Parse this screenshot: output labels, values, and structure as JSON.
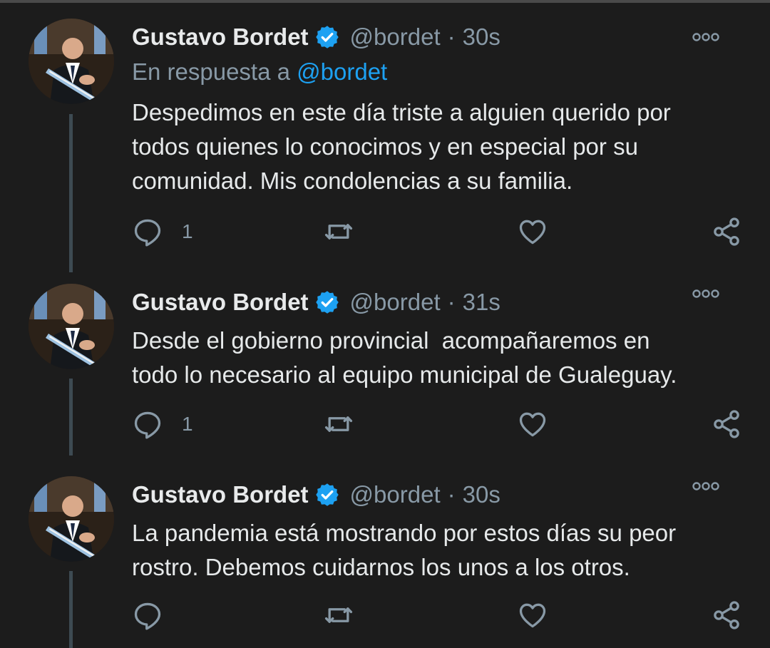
{
  "tweets": [
    {
      "name": "Gustavo Bordet",
      "handle": "@bordet",
      "separator": "·",
      "time": "30s",
      "reply_prefix": "En respuesta a",
      "reply_mention": "@bordet",
      "lines": [
        "Despedimos en este día triste a alguien querido por",
        "todos quienes lo conocimos y en especial por su",
        "comunidad. Mis condolencias a su familia."
      ],
      "reply_count": "1"
    },
    {
      "name": "Gustavo Bordet",
      "handle": "@bordet",
      "separator": "·",
      "time": "31s",
      "lines": [
        "Desde el gobierno provincial  acompañaremos en",
        "todo lo necesario al equipo municipal de Gualeguay."
      ],
      "reply_count": "1"
    },
    {
      "name": "Gustavo Bordet",
      "handle": "@bordet",
      "separator": "·",
      "time": "30s",
      "lines": [
        "La pandemia está mostrando por estos días su peor",
        "rostro. Debemos cuidarnos los unos a los otros."
      ],
      "reply_count": ""
    }
  ],
  "icons": {
    "reply": "reply-icon",
    "retweet": "retweet-icon",
    "like": "heart-icon",
    "share": "share-icon",
    "verified": "verified-badge-icon",
    "more": "more-options-icon"
  },
  "colors": {
    "background": "#1c1c1c",
    "text": "#e6e9ea",
    "muted": "#8899a6",
    "accent": "#1da1f2",
    "thread_line": "#3d4a52"
  }
}
